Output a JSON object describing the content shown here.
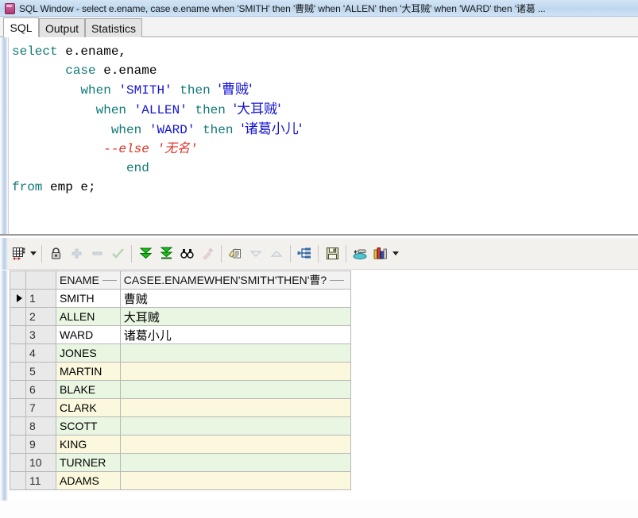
{
  "window": {
    "icon": "sql-window-icon",
    "title": "SQL Window - select e.ename, case e.ename when 'SMITH' then '曹贼' when 'ALLEN' then '大耳贼' when 'WARD' then '诸葛 ..."
  },
  "tabs": [
    {
      "label": "SQL",
      "active": true
    },
    {
      "label": "Output",
      "active": false
    },
    {
      "label": "Statistics",
      "active": false
    }
  ],
  "editor": {
    "lines": [
      [
        {
          "t": "select",
          "c": "kw"
        },
        {
          "t": " ",
          "c": "plain"
        },
        {
          "t": "e.ename,",
          "c": "plain"
        }
      ],
      [
        {
          "t": "       ",
          "c": "plain"
        },
        {
          "t": "case",
          "c": "kw"
        },
        {
          "t": " e.ename",
          "c": "plain"
        }
      ],
      [
        {
          "t": "         ",
          "c": "plain"
        },
        {
          "t": "when",
          "c": "kw"
        },
        {
          "t": " ",
          "c": "plain"
        },
        {
          "t": "'SMITH'",
          "c": "str"
        },
        {
          "t": " ",
          "c": "plain"
        },
        {
          "t": "then",
          "c": "kw"
        },
        {
          "t": " ",
          "c": "plain"
        },
        {
          "t": "'曹贼'",
          "c": "str cn"
        }
      ],
      [
        {
          "t": "           ",
          "c": "plain"
        },
        {
          "t": "when",
          "c": "kw"
        },
        {
          "t": " ",
          "c": "plain"
        },
        {
          "t": "'ALLEN'",
          "c": "str"
        },
        {
          "t": " ",
          "c": "plain"
        },
        {
          "t": "then",
          "c": "kw"
        },
        {
          "t": " ",
          "c": "plain"
        },
        {
          "t": "'大耳贼'",
          "c": "str cn"
        }
      ],
      [
        {
          "t": "             ",
          "c": "plain"
        },
        {
          "t": "when",
          "c": "kw"
        },
        {
          "t": " ",
          "c": "plain"
        },
        {
          "t": "'WARD'",
          "c": "str"
        },
        {
          "t": " ",
          "c": "plain"
        },
        {
          "t": "then",
          "c": "kw"
        },
        {
          "t": " ",
          "c": "plain"
        },
        {
          "t": "'诸葛小儿'",
          "c": "str cn"
        }
      ],
      [
        {
          "t": "            ",
          "c": "plain"
        },
        {
          "t": "--else '无名'",
          "c": "cmt"
        }
      ],
      [
        {
          "t": "               ",
          "c": "plain"
        },
        {
          "t": "end",
          "c": "kw"
        }
      ],
      [
        {
          "t": "from",
          "c": "kw"
        },
        {
          "t": " emp e;",
          "c": "plain"
        }
      ]
    ],
    "colors": {
      "keyword": "#117a77",
      "string": "#1414d2",
      "comment": "#e03020",
      "plain": "#000000"
    }
  },
  "toolbar": {
    "items": [
      {
        "name": "grid-layout-icon",
        "enabled": true,
        "dropdown": true
      },
      {
        "name": "lock-icon",
        "enabled": true
      },
      {
        "name": "insert-row-icon",
        "enabled": false
      },
      {
        "name": "delete-row-icon",
        "enabled": false
      },
      {
        "name": "post-change-icon",
        "enabled": false
      },
      {
        "name": "fetch-next-page-icon",
        "enabled": true
      },
      {
        "name": "fetch-last-page-icon",
        "enabled": true
      },
      {
        "name": "find-icon",
        "enabled": true
      },
      {
        "name": "edit-data-icon",
        "enabled": false
      },
      {
        "name": "copy-to-clipboard-icon",
        "enabled": true
      },
      {
        "name": "collapse-icon",
        "enabled": false
      },
      {
        "name": "expand-icon",
        "enabled": false
      },
      {
        "name": "export-structure-icon",
        "enabled": true
      },
      {
        "name": "save-icon",
        "enabled": true
      },
      {
        "name": "export-results-icon",
        "enabled": true
      },
      {
        "name": "chart-icon",
        "enabled": true,
        "dropdown": true
      }
    ]
  },
  "results": {
    "columns": [
      {
        "key": "ename",
        "label": "ENAME"
      },
      {
        "key": "case_expr",
        "label": "CASEE.ENAMEWHEN'SMITH'THEN'曹?"
      }
    ],
    "selected_row": 1,
    "rows": [
      {
        "n": 1,
        "ename": "SMITH",
        "case_expr": "曹贼",
        "band": "r-white"
      },
      {
        "n": 2,
        "ename": "ALLEN",
        "case_expr": "大耳贼",
        "band": "r-green"
      },
      {
        "n": 3,
        "ename": "WARD",
        "case_expr": "诸葛小儿",
        "band": "r-white"
      },
      {
        "n": 4,
        "ename": "JONES",
        "case_expr": "",
        "band": "r-green"
      },
      {
        "n": 5,
        "ename": "MARTIN",
        "case_expr": "",
        "band": "r-yellow"
      },
      {
        "n": 6,
        "ename": "BLAKE",
        "case_expr": "",
        "band": "r-green"
      },
      {
        "n": 7,
        "ename": "CLARK",
        "case_expr": "",
        "band": "r-yellow"
      },
      {
        "n": 8,
        "ename": "SCOTT",
        "case_expr": "",
        "band": "r-green"
      },
      {
        "n": 9,
        "ename": "KING",
        "case_expr": "",
        "band": "r-yellow"
      },
      {
        "n": 10,
        "ename": "TURNER",
        "case_expr": "",
        "band": "r-green"
      },
      {
        "n": 11,
        "ename": "ADAMS",
        "case_expr": "",
        "band": "r-yellow"
      }
    ]
  }
}
